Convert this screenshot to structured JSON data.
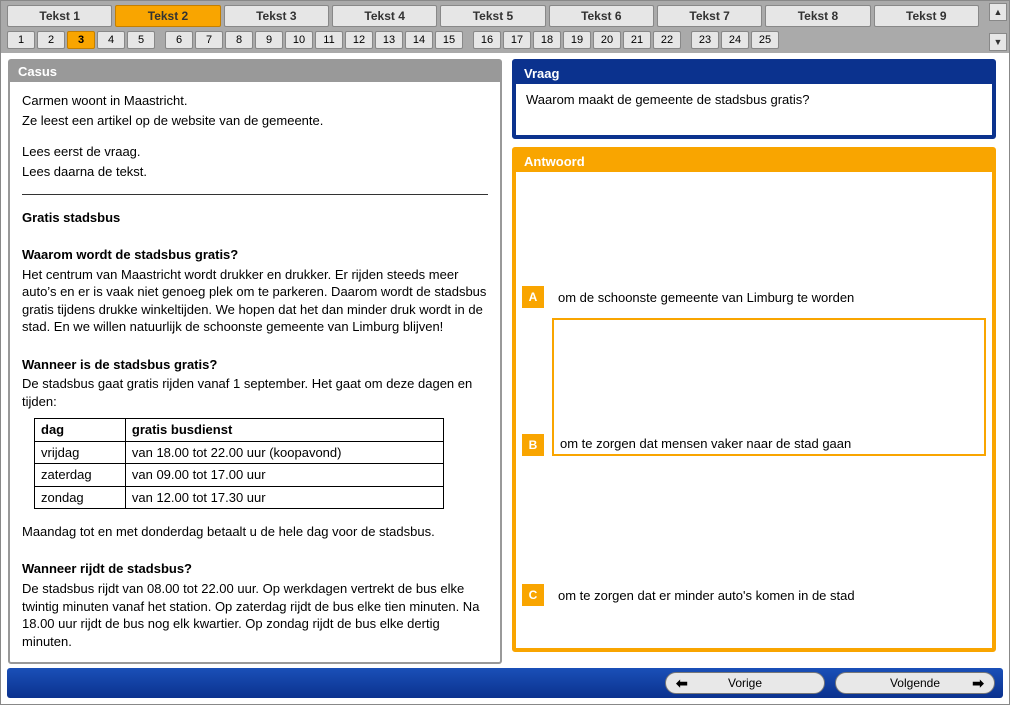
{
  "tabs": {
    "texts": [
      "Tekst 1",
      "Tekst 2",
      "Tekst 3",
      "Tekst 4",
      "Tekst 5",
      "Tekst 6",
      "Tekst 7",
      "Tekst 8",
      "Tekst 9"
    ],
    "active_text_index": 1,
    "numbers": [
      "1",
      "2",
      "3",
      "4",
      "5",
      "6",
      "7",
      "8",
      "9",
      "10",
      "11",
      "12",
      "13",
      "14",
      "15",
      "16",
      "17",
      "18",
      "19",
      "20",
      "21",
      "22",
      "23",
      "24",
      "25"
    ],
    "active_number_index": 2
  },
  "panels": {
    "casus_title": "Casus",
    "vraag_title": "Vraag",
    "antwoord_title": "Antwoord"
  },
  "casus": {
    "intro1": "Carmen woont in Maastricht.",
    "intro2": "Ze leest een artikel op de website van de gemeente.",
    "intro3": "Lees eerst de vraag.",
    "intro4": "Lees daarna de tekst.",
    "title": "Gratis stadsbus",
    "h1": "Waarom wordt de stadsbus gratis?",
    "p1": "Het centrum van Maastricht wordt drukker en drukker. Er rijden steeds meer auto’s en er is vaak niet genoeg plek om te parkeren. Daarom wordt de stadsbus gratis tijdens drukke winkeltijden. We hopen dat het dan minder druk wordt in de stad. En we willen natuurlijk de schoonste gemeente van Limburg blijven!",
    "h2": "Wanneer is de stadsbus gratis?",
    "p2": "De stadsbus gaat gratis rijden vanaf 1 september. Het gaat om deze dagen en tijden:",
    "table": {
      "head": [
        "dag",
        "gratis busdienst"
      ],
      "rows": [
        [
          "vrijdag",
          "van 18.00 tot 22.00 uur (koopavond)"
        ],
        [
          "zaterdag",
          "van 09.00 tot 17.00 uur"
        ],
        [
          "zondag",
          "van 12.00 tot 17.30 uur"
        ]
      ]
    },
    "p3": "Maandag tot en met donderdag betaalt u de hele dag voor de stadsbus.",
    "h3": "Wanneer rijdt de stadsbus?",
    "p4": "De stadsbus rijdt van 08.00 tot 22.00 uur. Op werkdagen vertrekt de bus elke twintig minuten vanaf het station. Op zaterdag rijdt de bus elke tien minuten. Na 18.00 uur rijdt de bus nog elk kwartier. Op zondag rijdt de bus elke dertig minuten."
  },
  "vraag": {
    "text": "Waarom maakt de gemeente de stadsbus gratis?"
  },
  "antwoord": {
    "options": [
      {
        "letter": "A",
        "text": "om de schoonste gemeente van Limburg te worden"
      },
      {
        "letter": "B",
        "text": "om te zorgen dat mensen vaker naar de stad gaan"
      },
      {
        "letter": "C",
        "text": "om te zorgen dat er minder auto's komen in de stad"
      }
    ]
  },
  "nav": {
    "prev": "Vorige",
    "next": "Volgende"
  }
}
